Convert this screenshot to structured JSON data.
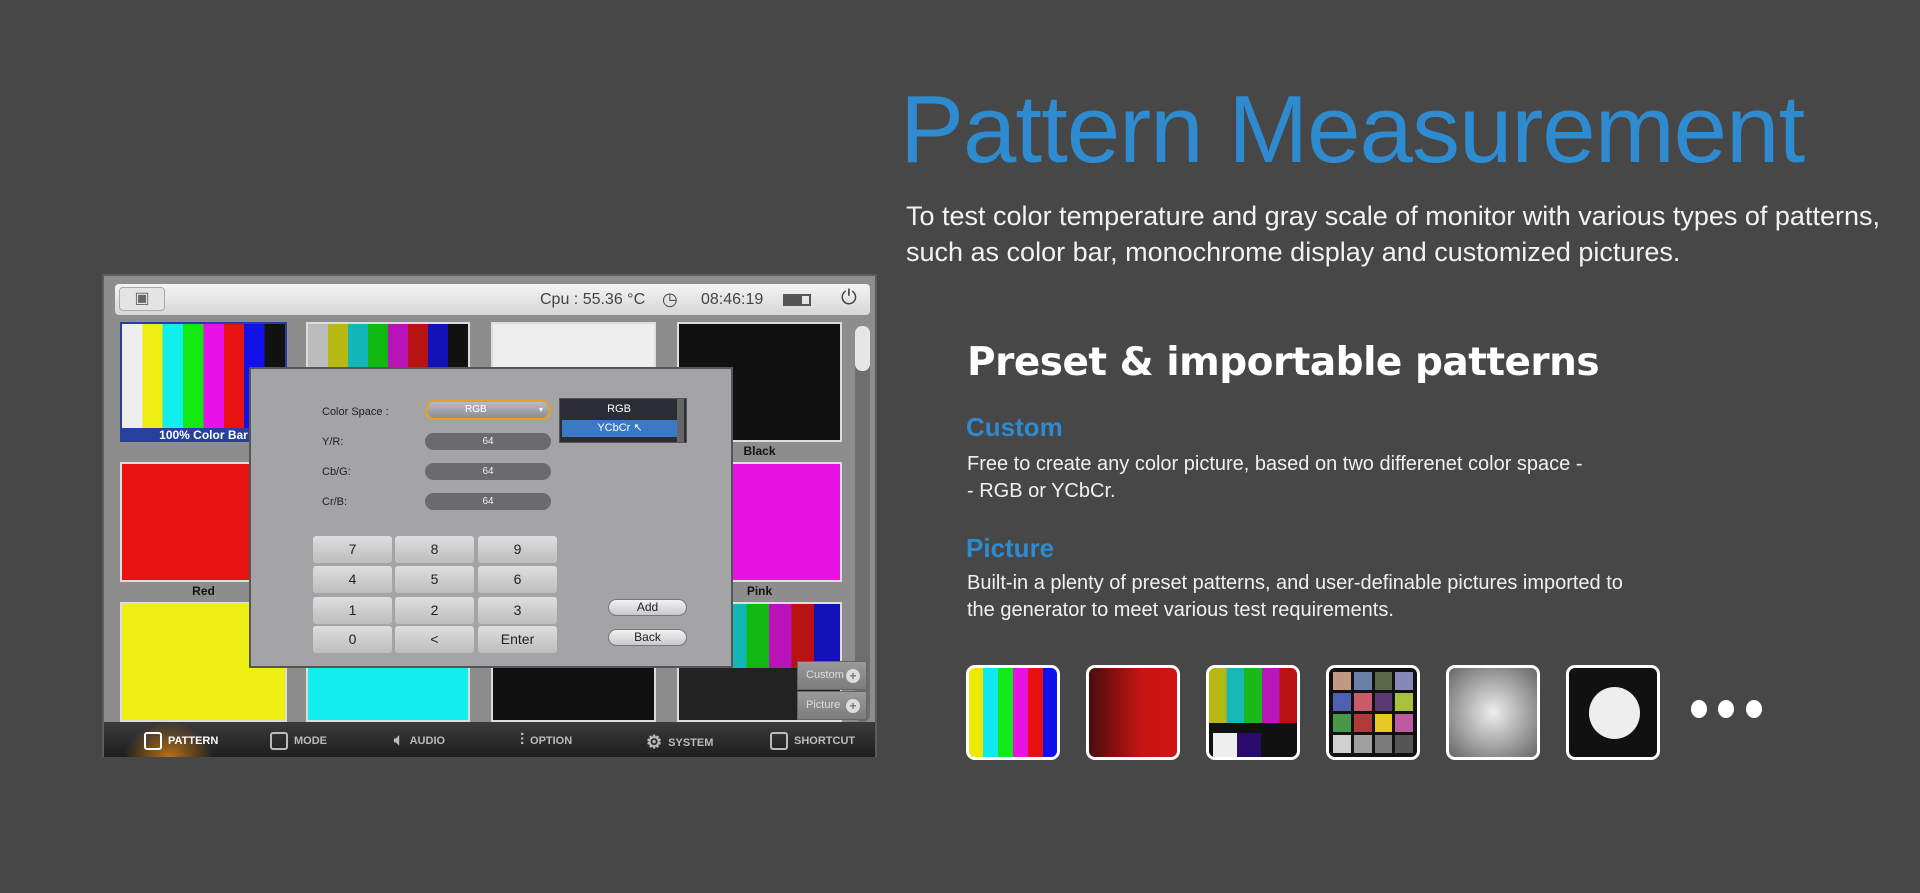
{
  "heading": {
    "title": "Pattern Measurement",
    "description": "To test color temperature and gray scale of monitor with various types of patterns, such as color bar, monochrome display and customized pictures."
  },
  "features": {
    "title": "Preset & importable patterns",
    "custom": {
      "heading": "Custom",
      "text_line1": "Free to create any color picture, based on two differenet color space -",
      "text_line2": "- RGB or YCbCr."
    },
    "picture": {
      "heading": "Picture",
      "text_line1": "Built-in a plenty of preset patterns, and user-definable pictures imported to",
      "text_line2": "the generator to meet various test requirements."
    }
  },
  "accent_color": "#2e8bd0",
  "device": {
    "topbar": {
      "cpu": "Cpu : 55.36 °C",
      "time": "08:46:19"
    },
    "tiles": [
      {
        "label": "100% Color Bar"
      },
      {
        "label": ""
      },
      {
        "label": ""
      },
      {
        "label": "Black"
      },
      {
        "label": "Red"
      },
      {
        "label": "Pink"
      }
    ],
    "dialog": {
      "color_space_label": "Color Space :",
      "color_space_value": "RGB",
      "options": [
        "RGB",
        "YCbCr"
      ],
      "selected_option": "YCbCr",
      "fields": [
        {
          "label": "Y/R:",
          "value": "64"
        },
        {
          "label": "Cb/G:",
          "value": "64"
        },
        {
          "label": "Cr/B:",
          "value": "64"
        }
      ],
      "keys": [
        "7",
        "8",
        "9",
        "4",
        "5",
        "6",
        "1",
        "2",
        "3",
        "0",
        "<",
        "Enter"
      ],
      "add": "Add",
      "back": "Back"
    },
    "side_buttons": {
      "custom": "Custom",
      "picture": "Picture"
    },
    "nav": [
      "PATTERN",
      "MODE",
      "AUDIO",
      "OPTION",
      "SYSTEM",
      "SHORTCUT"
    ],
    "active_nav": "PATTERN"
  }
}
